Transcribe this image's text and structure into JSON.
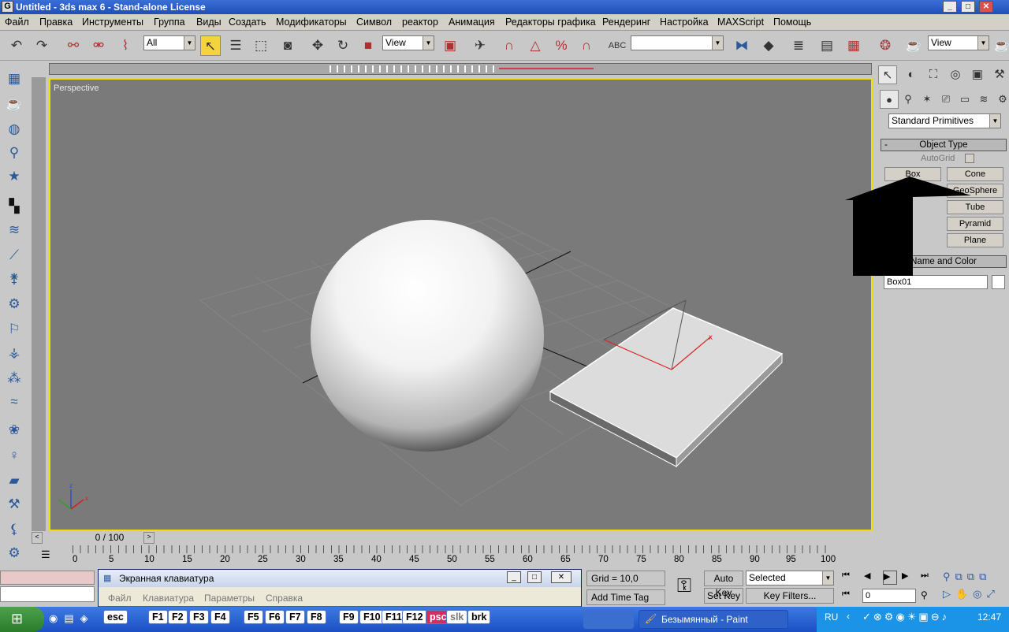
{
  "window": {
    "title": "Untitled - 3ds max 6 - Stand-alone License"
  },
  "menu": [
    "Файл",
    "Правка",
    "Инструменты",
    "Группа",
    "Виды",
    "Создать",
    "Модификаторы",
    "Символ",
    "реактор",
    "Анимация",
    "Редакторы графика",
    "Рендеринг",
    "Настройка",
    "MAXScript",
    "Помощь"
  ],
  "toolbar": {
    "selection_filter": "All",
    "ref_coord": "View",
    "view_dropdown": "View",
    "named_selection": ""
  },
  "viewport": {
    "label": "Perspective"
  },
  "command_panel": {
    "category": "Standard Primitives",
    "rollout_object_type": "Object Type",
    "autogrid_label": "AutoGrid",
    "buttons": [
      "Box",
      "Cone",
      "GeoSphere",
      "Tube",
      "Pyramid",
      "Plane"
    ],
    "rollout_name_color": "Name and Color",
    "name_value": "Box01"
  },
  "timeline": {
    "frame": "0 / 100"
  },
  "ruler_ticks": [
    "0",
    "5",
    "10",
    "15",
    "20",
    "25",
    "30",
    "35",
    "40",
    "45",
    "50",
    "55",
    "60",
    "65",
    "70",
    "75",
    "80",
    "85",
    "90",
    "95",
    "100"
  ],
  "status": {
    "grid": "Grid = 10,0",
    "add_time_tag": "Add Time Tag",
    "auto_key": "Auto Key",
    "set_key": "Set Key",
    "key_mode": "Selected",
    "key_filters": "Key Filters...",
    "frame_field": "0"
  },
  "osk": {
    "title": "Экранная клавиатура",
    "menu": [
      "Файл",
      "Клавиатура",
      "Параметры",
      "Справка"
    ],
    "keys": [
      "esc",
      "F1",
      "F2",
      "F3",
      "F4",
      "F5",
      "F6",
      "F7",
      "F8",
      "F9",
      "F10",
      "F11",
      "F12",
      "psc",
      "slk",
      "brk"
    ]
  },
  "taskbar": {
    "paint_task": "Безымянный - Paint",
    "lang": "RU",
    "clock": "12:47"
  }
}
